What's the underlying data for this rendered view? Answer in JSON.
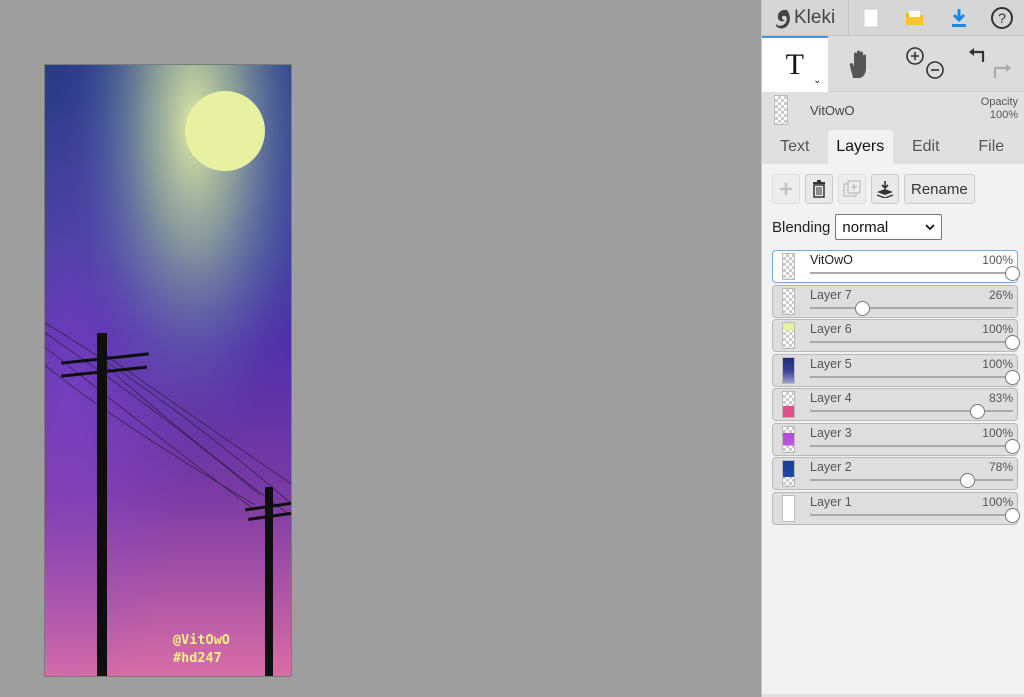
{
  "app": {
    "name": "Kleki"
  },
  "topbar": {
    "icons": [
      "new-image-icon",
      "open-folder-icon",
      "download-icon",
      "help-icon"
    ],
    "accent": "#1e88e5",
    "folder_color": "#f5b800"
  },
  "tools": {
    "text": {
      "glyph": "T",
      "caret": "⌄"
    },
    "icons": [
      "text-tool-icon",
      "hand-tool-icon",
      "zoom-icon",
      "undo-icon",
      "redo-icon"
    ]
  },
  "current_layer": {
    "name": "VitOwO",
    "opacity_label": "Opacity",
    "opacity_value": "100%"
  },
  "tabs": [
    {
      "label": "Text",
      "active": false
    },
    {
      "label": "Layers",
      "active": true
    },
    {
      "label": "Edit",
      "active": false
    },
    {
      "label": "File",
      "active": false
    }
  ],
  "layer_panel": {
    "rename_label": "Rename",
    "blending_label": "Blending",
    "blending_value": "normal",
    "layers": [
      {
        "name": "VitOwO",
        "percent": "100%",
        "opacity": 1.0,
        "selected": true
      },
      {
        "name": "Layer 7",
        "percent": "26%",
        "opacity": 0.26,
        "selected": false
      },
      {
        "name": "Layer 6",
        "percent": "100%",
        "opacity": 1.0,
        "selected": false
      },
      {
        "name": "Layer 5",
        "percent": "100%",
        "opacity": 1.0,
        "selected": false
      },
      {
        "name": "Layer 4",
        "percent": "83%",
        "opacity": 0.83,
        "selected": false
      },
      {
        "name": "Layer 3",
        "percent": "100%",
        "opacity": 1.0,
        "selected": false
      },
      {
        "name": "Layer 2",
        "percent": "78%",
        "opacity": 0.78,
        "selected": false
      },
      {
        "name": "Layer 1",
        "percent": "100%",
        "opacity": 1.0,
        "selected": false
      }
    ]
  },
  "artwork": {
    "signature_line1": "@VitOwO",
    "signature_line2": "#hd247",
    "colors": {
      "moon": "#eaf2a6",
      "sky_top": "#2a3c86",
      "sky_mid": "#4f2fa8",
      "sky_bottom": "#d36aa8",
      "poles": "#0e0e0e",
      "signature": "#f2f08a"
    }
  }
}
